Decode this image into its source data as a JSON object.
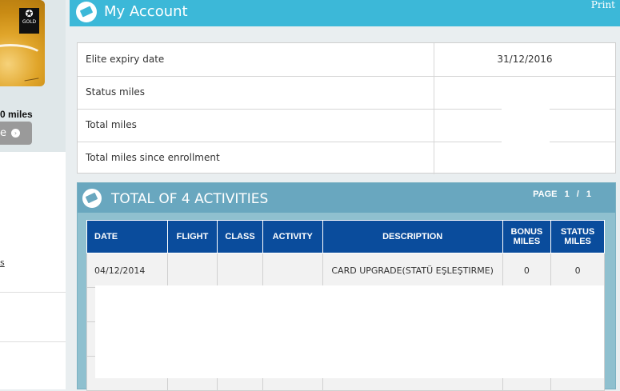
{
  "sidebar": {
    "card_logo_text": "GOLD",
    "miles_text": "0 miles",
    "button_label": "e",
    "link_text": "s"
  },
  "header": {
    "title": "My Account",
    "print_label": "Print"
  },
  "account_info": [
    {
      "label": "Elite expiry date",
      "value": "31/12/2016"
    },
    {
      "label": "Status miles",
      "value": ""
    },
    {
      "label": "Total miles",
      "value": ""
    },
    {
      "label": "Total miles since enrollment",
      "value": ""
    }
  ],
  "activities": {
    "title": "TOTAL OF 4 ACTIVITIES",
    "page_label": "PAGE",
    "page_current": "1",
    "page_sep": "/",
    "page_total": "1",
    "columns": {
      "date": "DATE",
      "flight": "FLIGHT",
      "class": "CLASS",
      "activity": "ACTIVITY",
      "description": "DESCRIPTION",
      "bonus": "BONUS MILES",
      "status": "STATUS MILES"
    },
    "rows": [
      {
        "date": "04/12/2014",
        "flight": "",
        "class": "",
        "activity": "",
        "description": "CARD UPGRADE(STATÜ EŞLEŞTIRME)",
        "bonus": "0",
        "status": "0"
      }
    ]
  },
  "colors": {
    "header": "#3cb8d8",
    "panel_header": "#69a7bf",
    "table_header": "#0a4c9c"
  },
  "icons": [
    "ticket-icon",
    "arrow-right-icon",
    "star-alliance-icon"
  ]
}
